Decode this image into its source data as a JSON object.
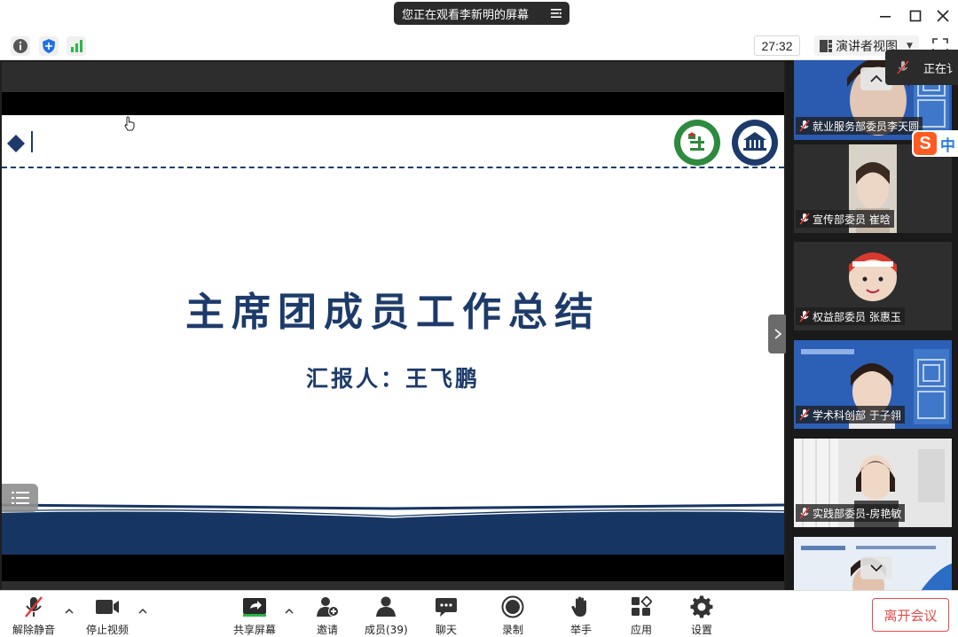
{
  "titlebar": {
    "share_notice": "您正在观看李新明的屏幕",
    "menu_icon": "list-menu-icon",
    "window_controls": [
      "minimize-icon",
      "maximize-icon",
      "close-icon"
    ]
  },
  "toolbar": {
    "left_icons": [
      "info-icon",
      "shield-icon",
      "signal-icon"
    ],
    "timer": "27:32",
    "view_mode": "演讲者视图",
    "fullscreen_icon": "fullscreen-icon"
  },
  "slide": {
    "title": "主席团成员工作总结",
    "reporter": "汇报人：王飞鹏",
    "colors": {
      "navy": "#1d3b6a",
      "book_blue": "#163563"
    }
  },
  "speaking_popup": {
    "text": "正在讠"
  },
  "sogou": {
    "badge": "S",
    "text": "中"
  },
  "participants": [
    {
      "name": "就业服务部委员李天圆",
      "muted": true
    },
    {
      "name": "宣传部委员 崔晗",
      "muted": true
    },
    {
      "name": "权益部委员 张惠玉",
      "muted": true
    },
    {
      "name": "学术科创部 于子翎",
      "muted": true
    },
    {
      "name": "实践部委员-房艳敏",
      "muted": true
    },
    {
      "name": "",
      "muted": true
    }
  ],
  "bottombar": {
    "buttons": [
      {
        "label": "解除静音",
        "icon": "mic-muted-icon"
      },
      {
        "label": "停止视频",
        "icon": "video-camera-icon"
      },
      {
        "label": "共享屏幕",
        "icon": "share-screen-icon"
      },
      {
        "label": "邀请",
        "icon": "invite-user-icon"
      },
      {
        "label": "成员(39)",
        "icon": "members-icon"
      },
      {
        "label": "聊天",
        "icon": "chat-icon"
      },
      {
        "label": "录制",
        "icon": "record-icon"
      },
      {
        "label": "举手",
        "icon": "raise-hand-icon"
      },
      {
        "label": "应用",
        "icon": "apps-icon"
      },
      {
        "label": "设置",
        "icon": "settings-gear-icon"
      }
    ],
    "leave_label": "离开会议"
  }
}
